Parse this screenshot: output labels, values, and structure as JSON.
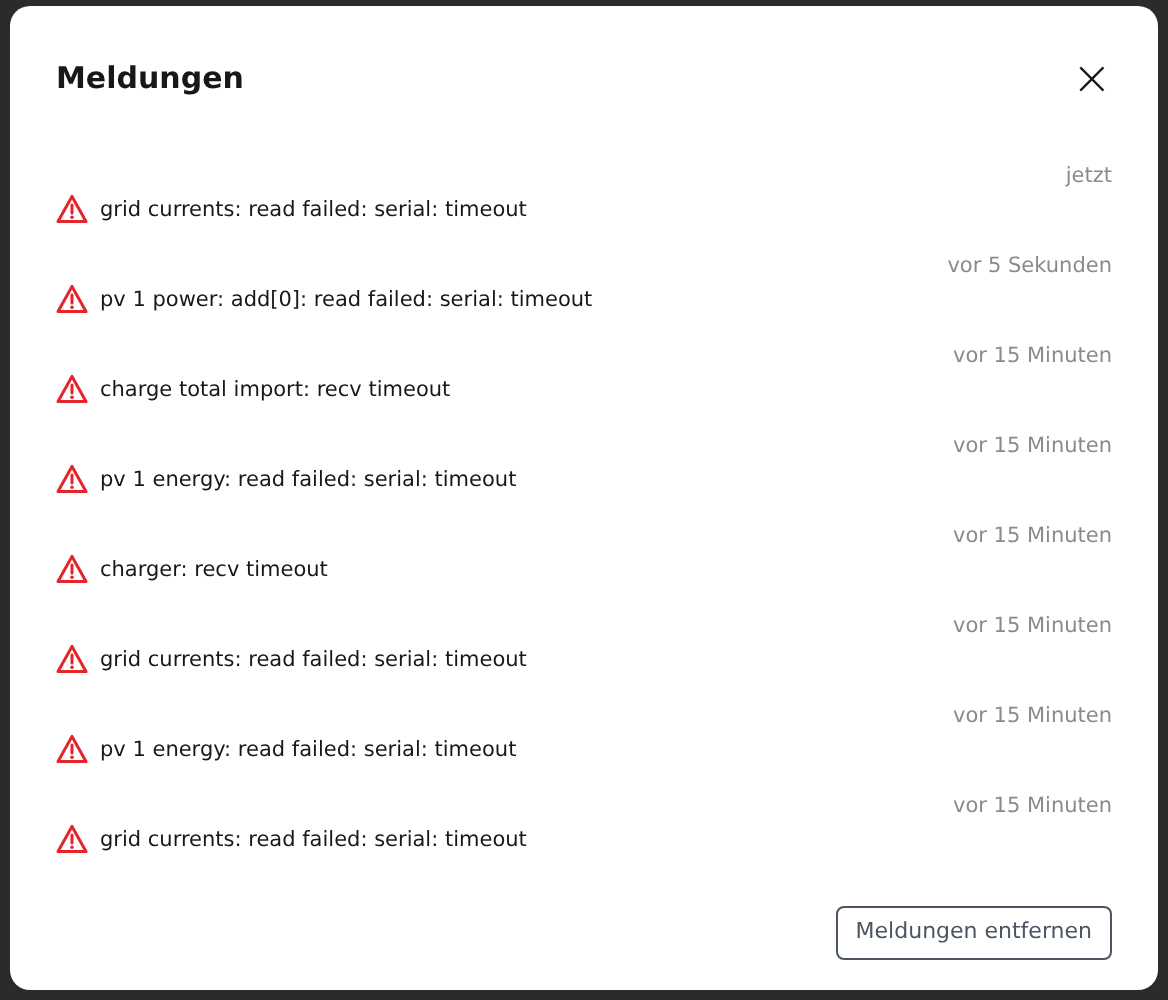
{
  "dialog": {
    "title": "Meldungen",
    "close_label": "×"
  },
  "messages": [
    {
      "time": "jetzt",
      "text": "grid currents: read failed: serial: timeout"
    },
    {
      "time": "vor 5 Sekunden",
      "text": "pv 1 power: add[0]: read failed: serial: timeout"
    },
    {
      "time": "vor 15 Minuten",
      "text": "charge total import: recv timeout"
    },
    {
      "time": "vor 15 Minuten",
      "text": "pv 1 energy: read failed: serial: timeout"
    },
    {
      "time": "vor 15 Minuten",
      "text": "charger: recv timeout"
    },
    {
      "time": "vor 15 Minuten",
      "text": "grid currents: read failed: serial: timeout"
    },
    {
      "time": "vor 15 Minuten",
      "text": "pv 1 energy: read failed: serial: timeout"
    },
    {
      "time": "vor 15 Minuten",
      "text": "grid currents: read failed: serial: timeout"
    }
  ],
  "button": "Meldungen entfernen"
}
